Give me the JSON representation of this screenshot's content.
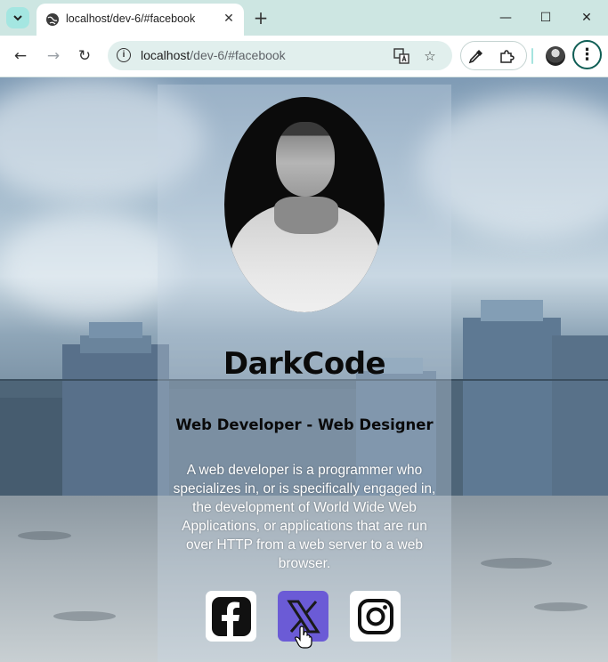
{
  "browser": {
    "tab_title": "localhost/dev-6/#facebook",
    "tab_close": "✕",
    "new_tab": "+",
    "minimize": "—",
    "maximize": "☐",
    "close_window": "✕",
    "url_host": "localhost",
    "url_path": "/dev-6/#facebook",
    "back": "←",
    "forward": "→",
    "reload": "↻",
    "menu": "⋮"
  },
  "profile": {
    "name": "DarkCode",
    "role": "Web Developer - Web Designer",
    "description": "A web developer is a programmer who specializes in, or is specifically engaged in, the development of World Wide Web Applications, or applications that are run over HTTP from a web server to a web browser."
  },
  "social": [
    {
      "icon": "facebook-icon",
      "color": "#ffffff"
    },
    {
      "icon": "x-icon",
      "color": "#6b5bd6"
    },
    {
      "icon": "instagram-icon",
      "color": "#ffffff"
    }
  ],
  "colors": {
    "tabstrip": "#cde6e2",
    "omnibox": "#e1efed",
    "accent": "#0f5e55"
  }
}
